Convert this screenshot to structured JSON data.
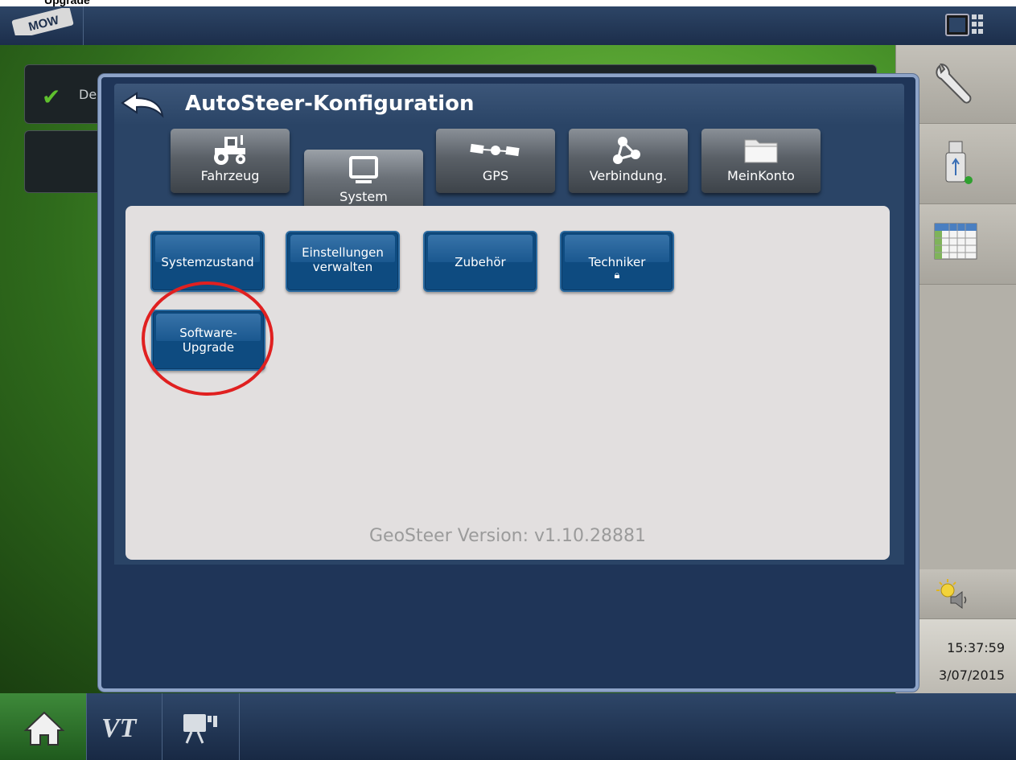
{
  "header_fragment": "Upgrade",
  "logo_text": "MOW",
  "background": {
    "row_text": "De"
  },
  "modal": {
    "title": "AutoSteer-Konfiguration",
    "tabs": [
      {
        "label": "Fahrzeug",
        "icon": "tractor-icon"
      },
      {
        "label": "System",
        "icon": "monitor-icon",
        "active": true
      },
      {
        "label": "GPS",
        "icon": "satellite-icon"
      },
      {
        "label": "Verbindung.",
        "icon": "network-icon"
      },
      {
        "label": "MeinKonto",
        "icon": "folder-icon"
      }
    ],
    "buttons": {
      "systemzustand": "Systemzustand",
      "einstellungen_1": "Einstellungen",
      "einstellungen_2": "verwalten",
      "zubehoer": "Zubehör",
      "techniker": "Techniker",
      "software_1": "Software-",
      "software_2": "Upgrade"
    },
    "version": "GeoSteer Version: v1.10.28881"
  },
  "status": {
    "time": "15:37:59",
    "date": "3/07/2015"
  },
  "bottom_nav": [
    {
      "icon": "home-icon"
    },
    {
      "icon": "vt-icon",
      "label": "VT"
    },
    {
      "icon": "camera-icon"
    }
  ],
  "colors": {
    "accent_button": "#0e4b80",
    "highlight": "#e02020",
    "modal_background": "#1f3558"
  }
}
